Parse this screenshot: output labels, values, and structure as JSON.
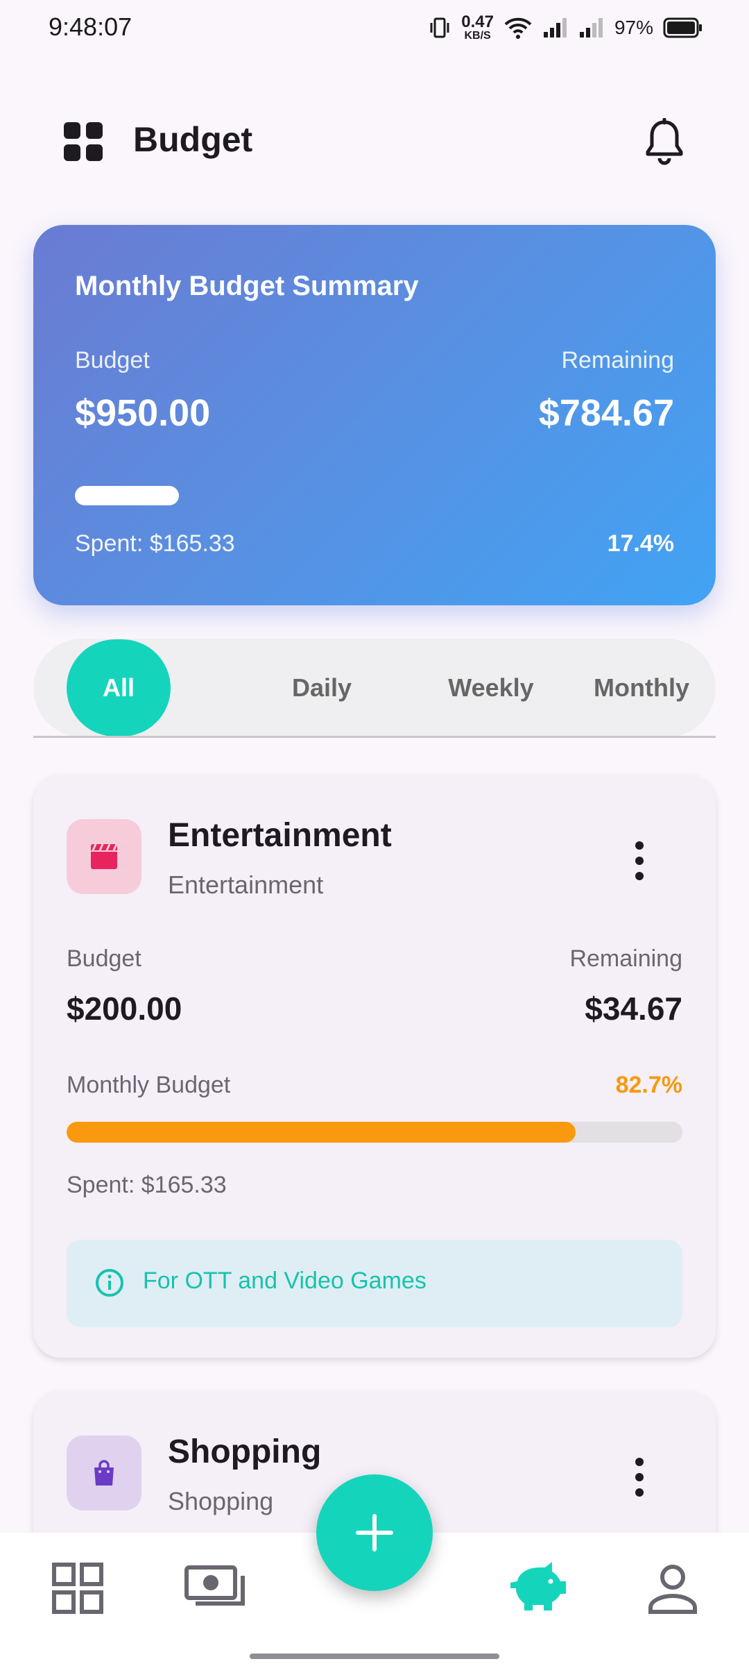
{
  "status_bar": {
    "time": "9:48:07",
    "net_speed_value": "0.47",
    "net_speed_unit": "KB/S",
    "battery": "97%"
  },
  "header": {
    "title": "Budget",
    "menu_icon": "grid-icon",
    "notification_icon": "bell-icon"
  },
  "summary": {
    "title": "Monthly Budget Summary",
    "budget_label": "Budget",
    "remaining_label": "Remaining",
    "budget_value": "$950.00",
    "remaining_value": "$784.67",
    "spent": "Spent: $165.33",
    "percent": "17.4%",
    "progress_fraction": 0.174
  },
  "tabs": [
    {
      "label": "All",
      "active": true
    },
    {
      "label": "Daily",
      "active": false
    },
    {
      "label": "Weekly",
      "active": false
    },
    {
      "label": "Monthly",
      "active": false
    }
  ],
  "budgets": [
    {
      "title": "Entertainment",
      "category": "Entertainment",
      "icon": "clapperboard-icon",
      "icon_color": "#E8245F",
      "icon_bg": "#F6CCDA",
      "budget_label": "Budget",
      "remaining_label": "Remaining",
      "budget_value": "$200.00",
      "remaining_value": "$34.67",
      "period": "Monthly Budget",
      "percent": "82.7%",
      "progress_fraction": 0.827,
      "spent": "Spent: $165.33",
      "note": "For OTT and Video Games"
    },
    {
      "title": "Shopping",
      "category": "Shopping",
      "icon": "shopping-bag-icon",
      "icon_color": "#6A3BC4",
      "icon_bg": "#E0D2EE"
    }
  ],
  "colors": {
    "accent": "#14D5BC",
    "warning": "#F8990F"
  },
  "bottom_nav": [
    {
      "icon": "dashboard-icon",
      "active": false
    },
    {
      "icon": "money-icon",
      "active": false
    },
    {
      "icon": "piggy-bank-icon",
      "active": true
    },
    {
      "icon": "profile-icon",
      "active": false
    }
  ],
  "fab": {
    "icon": "plus-icon"
  }
}
